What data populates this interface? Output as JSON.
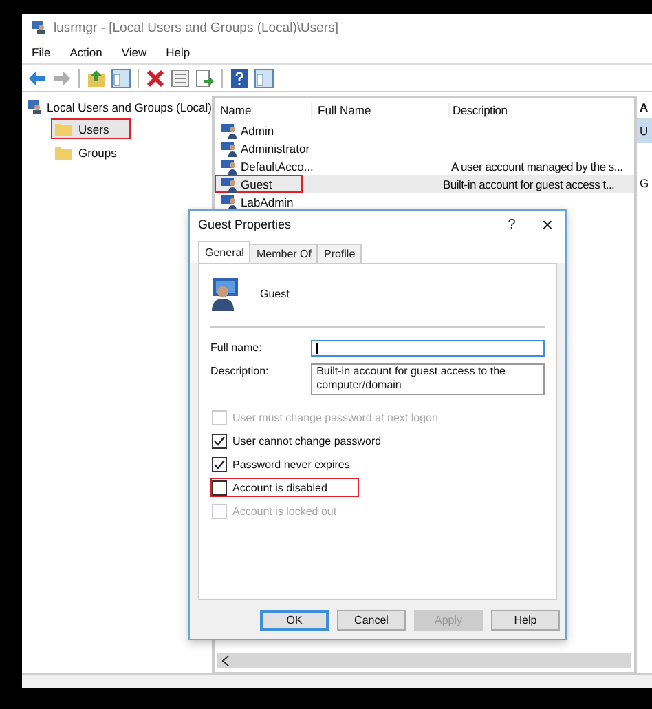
{
  "window": {
    "title": "lusrmgr - [Local Users and Groups (Local)\\Users]"
  },
  "menu": [
    "File",
    "Action",
    "View",
    "Help"
  ],
  "toolbar": [
    {
      "kind": "back",
      "disabled": false
    },
    {
      "kind": "forward",
      "disabled": true
    },
    {
      "kind": "separator"
    },
    {
      "kind": "up"
    },
    {
      "kind": "pane"
    },
    {
      "kind": "separator"
    },
    {
      "kind": "delete"
    },
    {
      "kind": "properties"
    },
    {
      "kind": "export"
    },
    {
      "kind": "separator"
    },
    {
      "kind": "help"
    },
    {
      "kind": "pane"
    }
  ],
  "tree": {
    "root": "Local Users and Groups (Local)",
    "children": [
      {
        "label": "Users",
        "selected": true,
        "highlighted": true
      },
      {
        "label": "Groups",
        "selected": false,
        "highlighted": false
      }
    ]
  },
  "list": {
    "columns": [
      "Name",
      "Full Name",
      "Description"
    ],
    "rows": [
      {
        "name": "Admin",
        "selected": false,
        "highlighted": false
      },
      {
        "name": "Administrator",
        "selected": false,
        "highlighted": false
      },
      {
        "name": "DefaultAcco...",
        "description": "A user account managed by the s...",
        "selected": false,
        "highlighted": false
      },
      {
        "name": "Guest",
        "description": "Built-in account for guest access t...",
        "selected": true,
        "highlighted": true
      },
      {
        "name": "LabAdmin",
        "selected": false,
        "highlighted": false
      }
    ]
  },
  "actions_pane": {
    "header": "A",
    "items": [
      {
        "label": "U",
        "selected": true
      },
      {
        "label": "G",
        "selected": false
      }
    ]
  },
  "dialog": {
    "title": "Guest Properties",
    "help": "?",
    "close": "×",
    "tabs": [
      {
        "label": "General",
        "selected": true
      },
      {
        "label": "Member Of",
        "selected": false
      },
      {
        "label": "Profile",
        "selected": false
      }
    ],
    "user": "Guest",
    "fields": [
      {
        "label": "Full name:",
        "focused": true
      },
      {
        "label": "Description:",
        "value": "Built-in account for guest access to the computer/domain",
        "focused": false
      }
    ],
    "checkboxes": [
      {
        "label": "User must change password at next logon",
        "checked": false,
        "disabled": true,
        "highlighted": false
      },
      {
        "label": "User cannot change password",
        "checked": true,
        "disabled": false,
        "highlighted": false
      },
      {
        "label": "Password never expires",
        "checked": true,
        "disabled": false,
        "highlighted": false
      },
      {
        "label": "Account is disabled",
        "checked": false,
        "disabled": false,
        "highlighted": true
      },
      {
        "label": "Account is locked out",
        "checked": false,
        "disabled": true,
        "highlighted": false
      }
    ],
    "buttons": [
      {
        "label": "OK",
        "default": true,
        "disabled": false
      },
      {
        "label": "Cancel",
        "default": false,
        "disabled": false
      },
      {
        "label": "Apply",
        "default": false,
        "disabled": true
      },
      {
        "label": "Help",
        "default": false,
        "disabled": false
      }
    ]
  }
}
